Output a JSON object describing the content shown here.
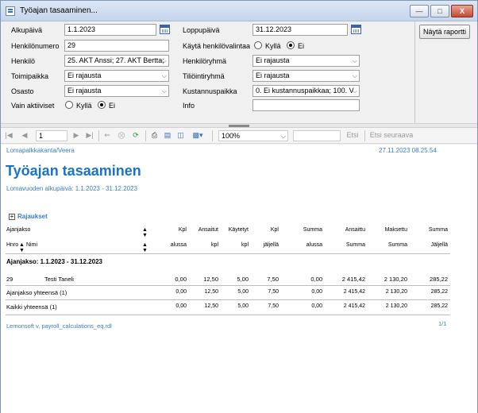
{
  "window": {
    "title": "Työajan tasaaminen...",
    "min": "—",
    "max": "□",
    "close": "X"
  },
  "form": {
    "alkupaiva": {
      "label": "Alkupäivä",
      "value": "1.1.2023"
    },
    "loppupaiva": {
      "label": "Loppupäivä",
      "value": "31.12.2023"
    },
    "henkilonumero": {
      "label": "Henkilönumero",
      "value": "29"
    },
    "kayta": {
      "label": "Käytä henkilövalintaa",
      "yes": "Kyllä",
      "no": "Ei"
    },
    "henkilo": {
      "label": "Henkilö",
      "value": "25. AKT Anssi; 27. AKT Bertta;"
    },
    "henkiloryhma": {
      "label": "Henkilöryhmä",
      "value": "Ei rajausta"
    },
    "toimipaikka": {
      "label": "Toimipaikka",
      "value": "Ei rajausta"
    },
    "tiliointiryhma": {
      "label": "Tiliöintiryhmä",
      "value": "Ei rajausta"
    },
    "osasto": {
      "label": "Osasto",
      "value": "Ei rajausta"
    },
    "kustannuspaikka": {
      "label": "Kustannuspaikka",
      "value": "0. Ei kustannuspaikkaa; 100. V"
    },
    "vain_aktiiviset": {
      "label": "Vain aktiiviset",
      "yes": "Kyllä",
      "no": "Ei"
    },
    "info": {
      "label": "Info",
      "value": ""
    },
    "report_button": "Näytä raportti"
  },
  "toolbar": {
    "page": "1",
    "zoom": "100%",
    "find": "Etsi",
    "find_next": "Etsi seuraava",
    "icons": [
      "first-page-icon",
      "prev-page-icon",
      "next-page-icon",
      "last-page-icon",
      "back-icon",
      "stop-icon",
      "refresh-icon",
      "print-icon",
      "print-layout-icon",
      "page-setup-icon",
      "export-icon"
    ]
  },
  "report": {
    "company": "Lomapalkkakanta/Veera",
    "timestamp": "27.11.2023 08.25.54",
    "title": "Työajan tasaaminen",
    "subtitle": "Lomavuoden alkupäivä: 1.1.2023 - 31.12.2023",
    "rajaukset": "Rajaukset",
    "headers1": [
      "Ajanjakso",
      "Kpl",
      "Ansaitut",
      "Käytetyt",
      "Kpl",
      "Summa",
      "Ansaittu",
      "Maksettu",
      "Summa"
    ],
    "headers2": [
      "Hnro",
      "Nimi",
      "alussa",
      "kpl",
      "kpl",
      "jäljellä",
      "alussa",
      "Summa",
      "Summa",
      "Jäljellä"
    ],
    "period": "Ajanjakso: 1.1.2023 - 31.12.2023",
    "rows": [
      {
        "hnro": "29",
        "nimi": "Testi Taneli",
        "v": [
          "0,00",
          "12,50",
          "5,00",
          "7,50",
          "0,00",
          "2 415,42",
          "2 130,20",
          "285,22"
        ]
      },
      {
        "hnro": "",
        "nimi": "Ajanjakso yhteensä (1)",
        "v": [
          "0,00",
          "12,50",
          "5,00",
          "7,50",
          "0,00",
          "2 415,42",
          "2 130,20",
          "285,22"
        ]
      },
      {
        "hnro": "",
        "nimi": "Kaikki yhteensä (1)",
        "v": [
          "0,00",
          "12,50",
          "5,00",
          "7,50",
          "0,00",
          "2 415,42",
          "2 130,20",
          "285,22"
        ]
      }
    ],
    "footer": "Lemonsoft v, payroll_calculations_eq.rdl",
    "pageinfo": "1/1"
  }
}
